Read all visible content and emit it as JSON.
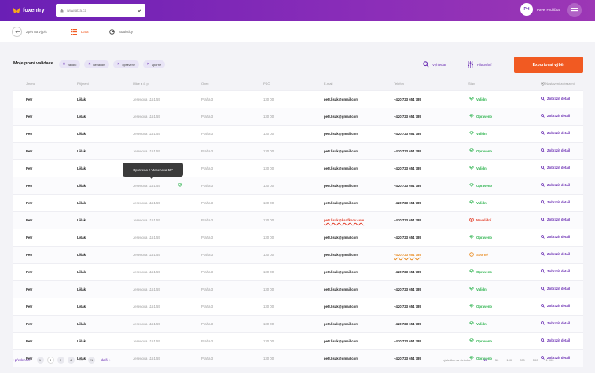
{
  "header": {
    "brand": "foxentry",
    "url": "www.alza.cz",
    "user_initials": "PH",
    "user_name": "Pavel Hrdlička"
  },
  "subnav": {
    "back_label": "Zpět na výpis",
    "tabs": [
      {
        "label": "Data",
        "active": true
      },
      {
        "label": "Statistiky",
        "active": false
      }
    ]
  },
  "toolbar": {
    "title": "Moje první validace",
    "filters": [
      "validní",
      "nevalidní",
      "opravené",
      "sporné"
    ],
    "search_label": "Vyhledat",
    "filter_label": "Filtrování",
    "export_label": "Exportovat výběr"
  },
  "table": {
    "columns": [
      "Jméno",
      "Příjmení",
      "Ulice a č. p.",
      "Obec",
      "PSČ",
      "E-mail",
      "Telefon",
      "Stav",
      "Nastavení zobrazení"
    ],
    "detail_label": "Zobrazit detail",
    "rows": [
      {
        "first": "Petr",
        "last": "Lišák",
        "street": "Jesenova 1151/55",
        "city": "Praha 3",
        "zip": "130 00",
        "email": "petr.lisak@gmail.com",
        "phone": "+420 723 654 789",
        "status": "Validní",
        "kind": "ok"
      },
      {
        "first": "Petr",
        "last": "Lišák",
        "street": "Jesenova 1151/55",
        "city": "Praha 3",
        "zip": "130 00",
        "email": "petr.lisak@gmail.com",
        "phone": "+420 723 654 789",
        "status": "Opraveno",
        "kind": "fix"
      },
      {
        "first": "Petr",
        "last": "Lišák",
        "street": "Jesenova 1151/55",
        "city": "Praha 3",
        "zip": "130 00",
        "email": "petr.lisak@gmail.com",
        "phone": "+420 723 654 789",
        "status": "Validní",
        "kind": "ok"
      },
      {
        "first": "Petr",
        "last": "Lišák",
        "street": "Jesenova 1151/55",
        "city": "Praha 3",
        "zip": "130 00",
        "email": "petr.lisak@gmail.com",
        "phone": "+420 723 654 789",
        "status": "Opraveno",
        "kind": "fix"
      },
      {
        "first": "Petr",
        "last": "Lišák",
        "street": "Jesenova 1151/55",
        "city": "Praha 3",
        "zip": "130 00",
        "email": "petr.lisak@gmail.com",
        "phone": "+420 723 654 789",
        "status": "Validní",
        "kind": "ok"
      },
      {
        "first": "Petr",
        "last": "Lišák",
        "street": "Jesenova 1151/55",
        "city": "Praha 3",
        "zip": "130 00",
        "email": "petr.lisak@gmail.com",
        "phone": "+420 723 654 789",
        "status": "Opraveno",
        "kind": "fix",
        "street_fixed": true
      },
      {
        "first": "Petr",
        "last": "Lišák",
        "street": "Jesenova 1151/55",
        "city": "Praha 3",
        "zip": "130 00",
        "email": "petr.lisak@gmail.com",
        "phone": "+420 723 654 789",
        "status": "Validní",
        "kind": "ok"
      },
      {
        "first": "Petr",
        "last": "Lišák",
        "street": "Jesenova 1151/55",
        "city": "Praha 3",
        "zip": "130 00",
        "email": "petr.lisak@ksdfksdv.com",
        "phone": "+420 723 654 789",
        "status": "Nevalidní",
        "kind": "bad",
        "email_err": true
      },
      {
        "first": "Petr",
        "last": "Lišák",
        "street": "Jesenova 1151/55",
        "city": "Praha 3",
        "zip": "130 00",
        "email": "petr.lisak@gmail.com",
        "phone": "+420 723 654 789",
        "status": "Opraveno",
        "kind": "fix"
      },
      {
        "first": "Petr",
        "last": "Lišák",
        "street": "Jesenova 1151/55",
        "city": "Praha 3",
        "zip": "130 00",
        "email": "petr.lisak@gmail.com",
        "phone": "+420 723 654 789",
        "status": "Sporné",
        "kind": "warn",
        "phone_warn": true
      },
      {
        "first": "Petr",
        "last": "Lišák",
        "street": "Jesenova 1151/55",
        "city": "Praha 3",
        "zip": "130 00",
        "email": "petr.lisak@gmail.com",
        "phone": "+420 723 654 789",
        "status": "Opraveno",
        "kind": "fix"
      },
      {
        "first": "Petr",
        "last": "Lišák",
        "street": "Jesenova 1151/55",
        "city": "Praha 3",
        "zip": "130 00",
        "email": "petr.lisak@gmail.com",
        "phone": "+420 723 654 789",
        "status": "Validní",
        "kind": "ok"
      },
      {
        "first": "Petr",
        "last": "Lišák",
        "street": "Jesenova 1151/55",
        "city": "Praha 3",
        "zip": "130 00",
        "email": "petr.lisak@gmail.com",
        "phone": "+420 723 654 789",
        "status": "Opraveno",
        "kind": "fix"
      },
      {
        "first": "Petr",
        "last": "Lišák",
        "street": "Jesenova 1151/55",
        "city": "Praha 3",
        "zip": "130 00",
        "email": "petr.lisak@gmail.com",
        "phone": "+420 723 654 789",
        "status": "Validní",
        "kind": "ok"
      },
      {
        "first": "Petr",
        "last": "Lišák",
        "street": "Jesenova 1151/55",
        "city": "Praha 3",
        "zip": "130 00",
        "email": "petr.lisak@gmail.com",
        "phone": "+420 723 654 789",
        "status": "Opraveno",
        "kind": "fix"
      },
      {
        "first": "Petr",
        "last": "Lišák",
        "street": "Jesenova 1151/55",
        "city": "Praha 3",
        "zip": "130 00",
        "email": "petr.lisak@gmail.com",
        "phone": "+420 723 654 789",
        "status": "Opraveno",
        "kind": "fix"
      }
    ]
  },
  "tooltip": {
    "text": "Opraveno z \"Jesenova 55\""
  },
  "pagination": {
    "prev_label": "předchozí",
    "next_label": "další",
    "pages": [
      "1",
      "2",
      "3",
      "4",
      "...",
      "21"
    ],
    "current": "2",
    "per_page_label": "výsledků na stránku:",
    "per_page_options": [
      "15",
      "50",
      "100",
      "200",
      "500",
      "1 000"
    ],
    "per_page_selected": "15"
  },
  "colors": {
    "brand_purple": "#6b2fb3",
    "accent_orange": "#f15a22",
    "valid_green": "#2bb24c",
    "invalid_red": "#e23d28",
    "disputed_orange": "#e8891d"
  }
}
